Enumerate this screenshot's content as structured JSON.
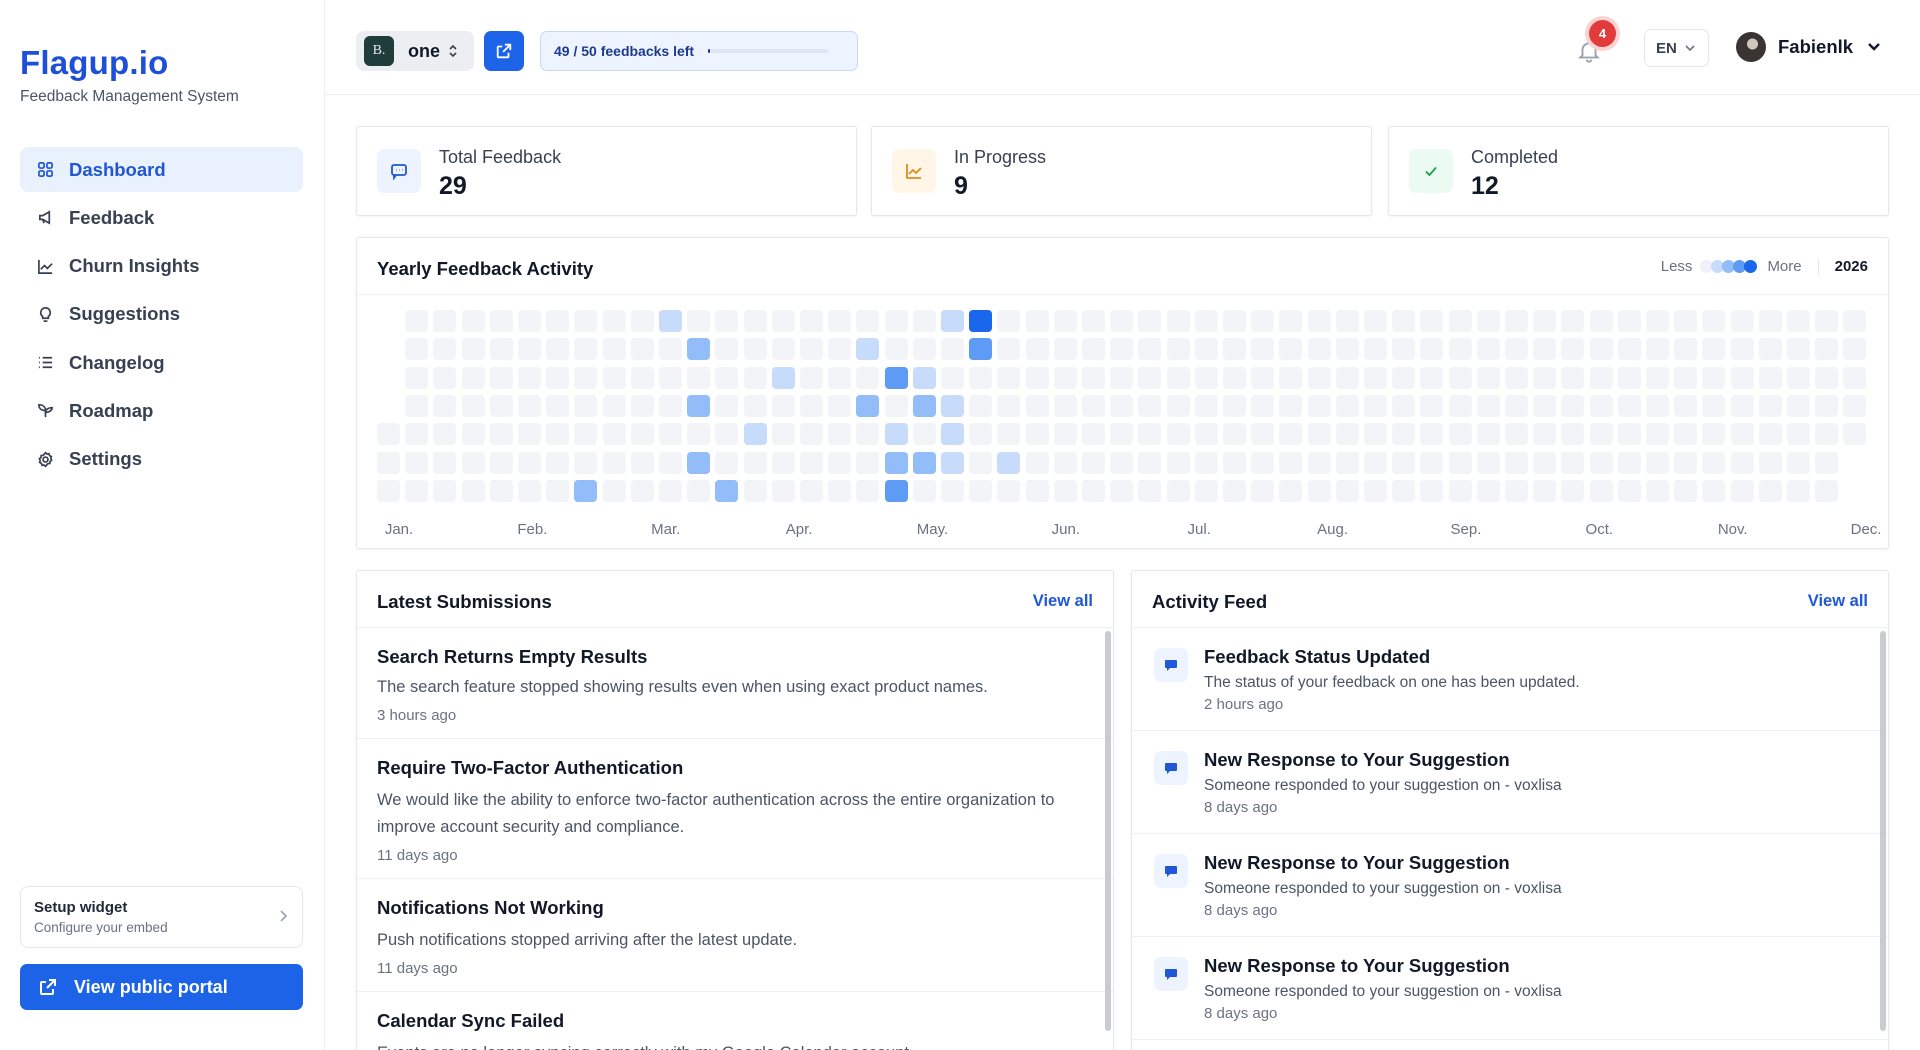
{
  "brand": {
    "title": "Flagup.io",
    "subtitle": "Feedback Management System"
  },
  "sidebar": {
    "items": [
      {
        "label": "Dashboard",
        "icon": "grid-icon",
        "active": true
      },
      {
        "label": "Feedback",
        "icon": "megaphone-icon"
      },
      {
        "label": "Churn Insights",
        "icon": "chart-icon"
      },
      {
        "label": "Suggestions",
        "icon": "lightbulb-icon"
      },
      {
        "label": "Changelog",
        "icon": "list-icon"
      },
      {
        "label": "Roadmap",
        "icon": "route-icon"
      },
      {
        "label": "Settings",
        "icon": "gear-icon"
      }
    ],
    "setup": {
      "title": "Setup widget",
      "subtitle": "Configure your embed"
    },
    "portal_label": "View public portal"
  },
  "topbar": {
    "workspace_initial": "B.",
    "workspace_name": "one",
    "quota_text": "49 / 50 feedbacks left",
    "quota_fraction": 0.02,
    "notifications": "4",
    "language": "EN",
    "user_name": "Fabienlk"
  },
  "stats": [
    {
      "label": "Total Feedback",
      "value": "29",
      "icon": "chat-icon",
      "color": "#1f57d6",
      "bg": "#eef4ff"
    },
    {
      "label": "In Progress",
      "value": "9",
      "icon": "trend-icon",
      "color": "#e08a1e",
      "bg": "#fff6e8"
    },
    {
      "label": "Completed",
      "value": "12",
      "icon": "check-icon",
      "color": "#16a34a",
      "bg": "#ecfbf1"
    }
  ],
  "heatmap": {
    "title": "Yearly Feedback Activity",
    "less": "Less",
    "more": "More",
    "year": "2026",
    "months": [
      "Jan.",
      "Feb.",
      "Mar.",
      "Apr.",
      "May.",
      "Jun.",
      "Jul.",
      "Aug.",
      "Sep.",
      "Oct.",
      "Nov.",
      "Dec."
    ],
    "colors": [
      "#f2f4f8",
      "#c7dbfb",
      "#93bdf8",
      "#5d9bf4",
      "#1a66ec"
    ],
    "active": [
      [
        10,
        0,
        1
      ],
      [
        20,
        0,
        1
      ],
      [
        21,
        0,
        4
      ],
      [
        11,
        1,
        2
      ],
      [
        17,
        1,
        1
      ],
      [
        21,
        1,
        3
      ],
      [
        14,
        2,
        1
      ],
      [
        18,
        2,
        3
      ],
      [
        19,
        2,
        1
      ],
      [
        11,
        3,
        2
      ],
      [
        17,
        3,
        2
      ],
      [
        19,
        3,
        2
      ],
      [
        20,
        3,
        1
      ],
      [
        13,
        4,
        1
      ],
      [
        18,
        4,
        1
      ],
      [
        20,
        4,
        1
      ],
      [
        11,
        5,
        2
      ],
      [
        18,
        5,
        2
      ],
      [
        19,
        5,
        2
      ],
      [
        20,
        5,
        1
      ],
      [
        22,
        5,
        1
      ],
      [
        7,
        6,
        2
      ],
      [
        12,
        6,
        2
      ],
      [
        18,
        6,
        3
      ]
    ]
  },
  "submissions": {
    "title": "Latest Submissions",
    "view_all": "View all",
    "items": [
      {
        "title": "Search Returns Empty Results",
        "desc": "The search feature stopped showing results even when using exact product names.",
        "time": "3 hours ago"
      },
      {
        "title": "Require Two-Factor Authentication",
        "desc": "We would like the ability to enforce two-factor authentication across the entire organization to improve account security and compliance.",
        "time": "11 days ago"
      },
      {
        "title": "Notifications Not Working",
        "desc": "Push notifications stopped arriving after the latest update.",
        "time": "11 days ago"
      },
      {
        "title": "Calendar Sync Failed",
        "desc": "Events are no longer syncing correctly with my Google Calendar account.",
        "time": ""
      }
    ]
  },
  "activity": {
    "title": "Activity Feed",
    "view_all": "View all",
    "items": [
      {
        "title": "Feedback Status Updated",
        "desc": "The status of your feedback on one has been updated.",
        "time": "2 hours ago"
      },
      {
        "title": "New Response to Your Suggestion",
        "desc": "Someone responded to your suggestion on - voxlisa",
        "time": "8 days ago"
      },
      {
        "title": "New Response to Your Suggestion",
        "desc": "Someone responded to your suggestion on - voxlisa",
        "time": "8 days ago"
      },
      {
        "title": "New Response to Your Suggestion",
        "desc": "Someone responded to your suggestion on - voxlisa",
        "time": "8 days ago"
      }
    ]
  }
}
